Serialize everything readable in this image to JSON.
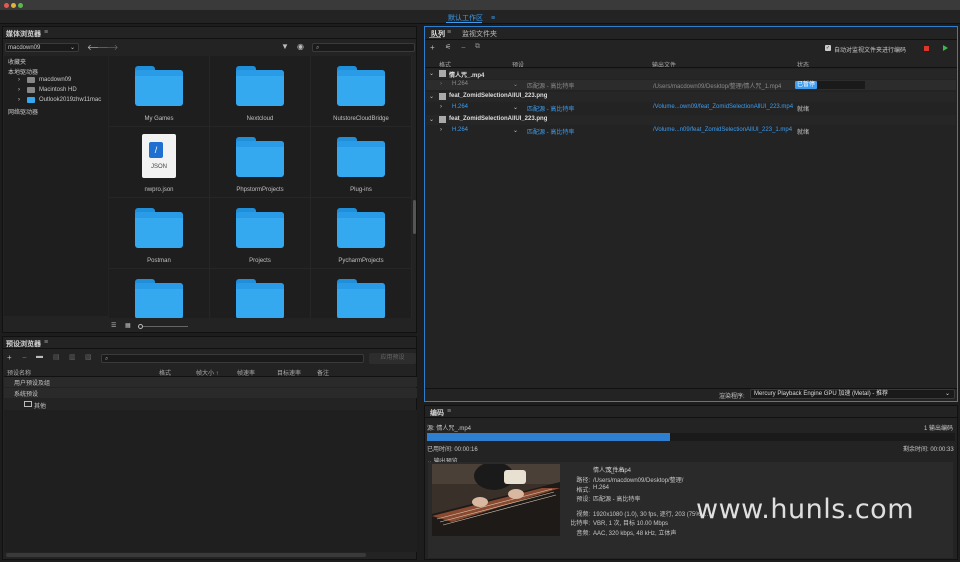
{
  "window": {
    "workspace_title": "默认工作区",
    "workspace_menu": "≡"
  },
  "media_browser": {
    "title": "媒体浏览器",
    "location": "macdown09",
    "tree": [
      {
        "label": "收藏夹",
        "level": 0
      },
      {
        "label": "本地驱动器",
        "level": 0
      },
      {
        "label": "macdown09",
        "level": 1
      },
      {
        "label": "Macintosh HD",
        "level": 1
      },
      {
        "label": "Outlook2019zhw11mac",
        "level": 1
      },
      {
        "label": "网络驱动器",
        "level": 0
      }
    ],
    "items": [
      "My Games",
      "Nextcloud",
      "NutstoreCloudBridge",
      "nwpro.json",
      "PhpstormProjects",
      "Plug-ins",
      "Postman",
      "Projects",
      "PycharmProjects"
    ],
    "json_label": "JSON"
  },
  "preset_browser": {
    "title": "预设浏览器",
    "apply_button": "应用预设",
    "columns": {
      "name": "预设名称",
      "format": "格式",
      "size": "帧大小 ↑",
      "fps": "帧速率",
      "target": "目标速率",
      "note": "备注"
    },
    "groups": [
      {
        "label": "用户预设及组",
        "indent": 0
      },
      {
        "label": "系统预设",
        "indent": 0
      },
      {
        "label": "其他",
        "indent": 1
      }
    ]
  },
  "queue": {
    "tabs": [
      "队列",
      "监视文件夹"
    ],
    "auto_encode": "自动对监视文件夹进行编码",
    "columns": {
      "format": "格式",
      "preset": "预设",
      "output": "输出文件",
      "status": "状态"
    },
    "jobs": [
      {
        "name": "情人咒_.mp4",
        "format": "H.264",
        "preset": "匹配源 - 高比特率",
        "output": "/Users/macdown09/Desktop/整理/情人咒_1.mp4",
        "status": "已暂停",
        "active": false
      },
      {
        "name": "feat_ZomidSelectionAllUI_223.png",
        "format": "H.264",
        "preset": "匹配源 - 高比特率",
        "output": "/Volume...own09/feat_ZomidSelectionAllUI_223.mp4",
        "status": "就绪",
        "active": true
      },
      {
        "name": "feat_ZomidSelectionAllUI_223.png",
        "format": "H.264",
        "preset": "匹配源 - 高比特率",
        "output": "/Volume...n09/feat_ZomidSelectionAllUI_223_1.mp4",
        "status": "就绪",
        "active": true
      }
    ],
    "renderer_label": "渲染程序:",
    "renderer_value": "Mercury Playback Engine GPU 加速 (Metal) - 推荐"
  },
  "encoding": {
    "title": "编码",
    "source": "源: 情人咒_.mp4",
    "outputs": "1 输出编码",
    "progress": 0.46,
    "elapsed": "已用时间: 00:00:16",
    "remaining": "剩余时间: 00:00:33",
    "preview_label": "输出预览",
    "details": [
      {
        "k": "文件名:",
        "v": "情人咒_1.mp4"
      },
      {
        "k": "路径:",
        "v": "/Users/macdown09/Desktop/整理/"
      },
      {
        "k": "格式:",
        "v": "H.264"
      },
      {
        "k": "预设:",
        "v": "匹配源 - 高比特率"
      },
      {
        "k": "视频:",
        "v": "1920x1080 (1.0), 30 fps, 逐行, 203 (75% …"
      },
      {
        "k": "比特率:",
        "v": "VBR, 1 次, 目标 10.00 Mbps"
      },
      {
        "k": "音频:",
        "v": "AAC, 320 kbps, 48 kHz, 立体声"
      }
    ]
  },
  "watermark": "www.hunls.com"
}
